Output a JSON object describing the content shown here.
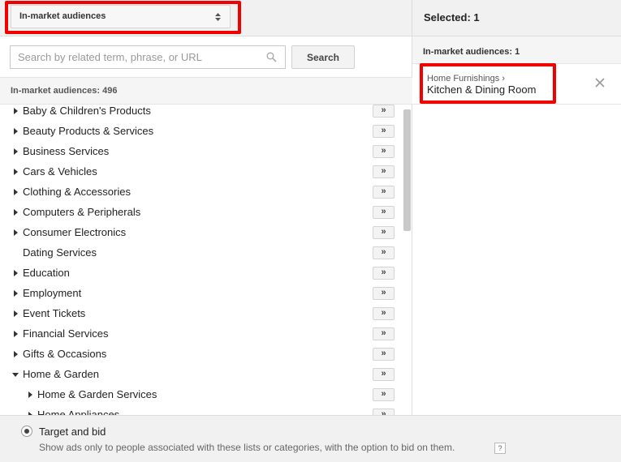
{
  "type_select": {
    "value": "In-market audiences"
  },
  "search": {
    "placeholder": "Search by related term, phrase, or URL",
    "button_label": "Search",
    "icon": "search-icon"
  },
  "left_count_label": "In-market audiences: 496",
  "categories": [
    {
      "label": "Baby & Children's Products",
      "expandable": true,
      "expanded": false,
      "level": 0
    },
    {
      "label": "Beauty Products & Services",
      "expandable": true,
      "expanded": false,
      "level": 0
    },
    {
      "label": "Business Services",
      "expandable": true,
      "expanded": false,
      "level": 0
    },
    {
      "label": "Cars & Vehicles",
      "expandable": true,
      "expanded": false,
      "level": 0
    },
    {
      "label": "Clothing & Accessories",
      "expandable": true,
      "expanded": false,
      "level": 0
    },
    {
      "label": "Computers & Peripherals",
      "expandable": true,
      "expanded": false,
      "level": 0
    },
    {
      "label": "Consumer Electronics",
      "expandable": true,
      "expanded": false,
      "level": 0
    },
    {
      "label": "Dating Services",
      "expandable": false,
      "expanded": false,
      "level": 0
    },
    {
      "label": "Education",
      "expandable": true,
      "expanded": false,
      "level": 0
    },
    {
      "label": "Employment",
      "expandable": true,
      "expanded": false,
      "level": 0
    },
    {
      "label": "Event Tickets",
      "expandable": true,
      "expanded": false,
      "level": 0
    },
    {
      "label": "Financial Services",
      "expandable": true,
      "expanded": false,
      "level": 0
    },
    {
      "label": "Gifts & Occasions",
      "expandable": true,
      "expanded": false,
      "level": 0
    },
    {
      "label": "Home & Garden",
      "expandable": true,
      "expanded": true,
      "level": 0
    },
    {
      "label": "Home & Garden Services",
      "expandable": true,
      "expanded": false,
      "level": 1
    },
    {
      "label": "Home Appliances",
      "expandable": true,
      "expanded": false,
      "level": 1
    }
  ],
  "add_button_label": "»",
  "selected_header": "Selected: 1",
  "selected_subhead": "In-market audiences: 1",
  "selected_item": {
    "crumb": "Home Furnishings ›",
    "name": "Kitchen & Dining Room",
    "remove_icon": "close-icon"
  },
  "targeting": {
    "option_label": "Target and bid",
    "option_help": "Show ads only to people associated with these lists or categories, with the option to bid on them.",
    "help_label": "?"
  },
  "colors": {
    "highlight": "#f20000",
    "panel_header": "#f1f1f1"
  }
}
